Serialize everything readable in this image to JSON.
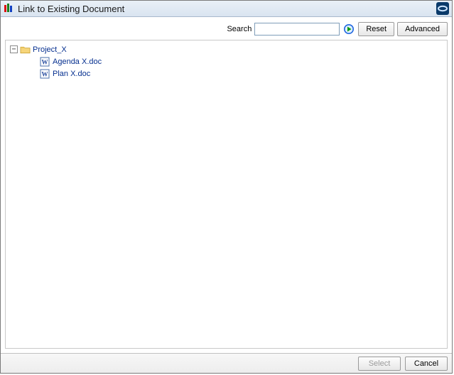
{
  "title": "Link to Existing Document",
  "search": {
    "label": "Search",
    "value": "",
    "reset_label": "Reset",
    "advanced_label": "Advanced"
  },
  "tree": {
    "root": {
      "name": "Project_X",
      "expanded": true,
      "children": [
        {
          "name": "Agenda X.doc"
        },
        {
          "name": "Plan X.doc"
        }
      ]
    }
  },
  "footer": {
    "select_label": "Select",
    "cancel_label": "Cancel",
    "select_enabled": false
  }
}
